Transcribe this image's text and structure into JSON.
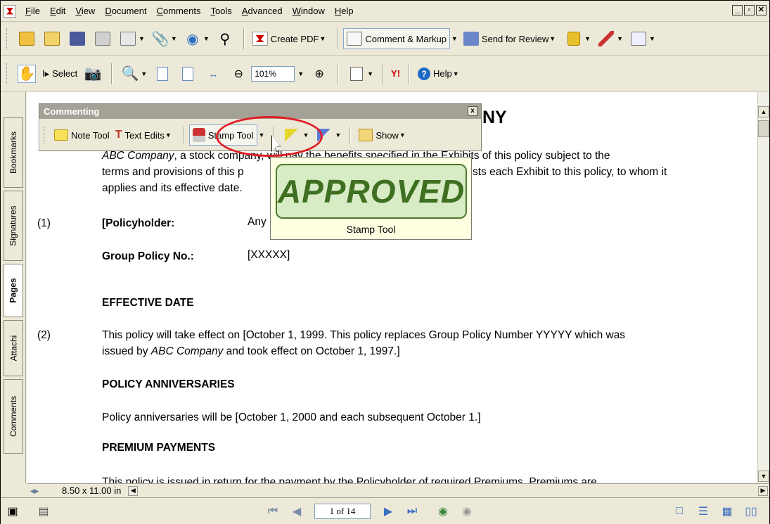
{
  "menu": {
    "items": [
      "File",
      "Edit",
      "View",
      "Document",
      "Comments",
      "Tools",
      "Advanced",
      "Window",
      "Help"
    ]
  },
  "toolbar1": {
    "create_pdf": "Create PDF",
    "comment_markup": "Comment & Markup",
    "send_for_review": "Send for Review"
  },
  "toolbar2": {
    "select": "Select",
    "zoom": "101%",
    "help": "Help",
    "yahoo": "Y!"
  },
  "nav_tabs": {
    "bookmarks": "Bookmarks",
    "signatures": "Signatures",
    "pages": "Pages",
    "attachments": "Attachi",
    "comments": "Comments"
  },
  "commenting": {
    "title": "Commenting",
    "note_tool": "Note Tool",
    "text_edits": "Text Edits",
    "stamp_tool": "Stamp Tool",
    "show": "Show",
    "close": "x"
  },
  "tooltip": {
    "stamp_text": "APPROVED",
    "label": "Stamp Tool"
  },
  "document": {
    "title_fragment": "NY",
    "para1_line1_a": "ABC Company",
    "para1_line1_b": ", a stock company, will pay the benefits specified in the Exhibits of this policy subject to the",
    "para1_line2_a": "terms and provisions of this p",
    "para1_line2_b": "sts each Exhibit to this policy, to whom it",
    "para1_line3": "applies and its effective date.",
    "n1": "(1)",
    "policyholder_label": "[Policyholder:",
    "policyholder_value": "Any",
    "group_policy_label": "Group Policy No.:",
    "group_policy_value": "[XXXXX]",
    "effective_date": "EFFECTIVE DATE",
    "n2": "(2)",
    "para2_line1": "This policy will take effect on [October 1, 1999.  This policy replaces Group Policy Number YYYYY which was",
    "para2_line2_a": "issued by ",
    "para2_line2_b": "ABC Company",
    "para2_line2_c": " and took effect on October 1, 1997.]",
    "policy_anniversaries": "POLICY ANNIVERSARIES",
    "para3": "Policy anniversaries will be [October 1, 2000 and each subsequent October 1.]",
    "premium_payments": "PREMIUM PAYMENTS",
    "para4_partial": "This policy is issued in return for the payment by the Policyholder of required Premiums.  Premiums are"
  },
  "status": {
    "page_size": "8.50 x 11.00 in",
    "page_indicator": "1 of 14"
  },
  "colors": {
    "highlight_ring": "#e01f26",
    "stamp_green": "#3f6f21"
  }
}
